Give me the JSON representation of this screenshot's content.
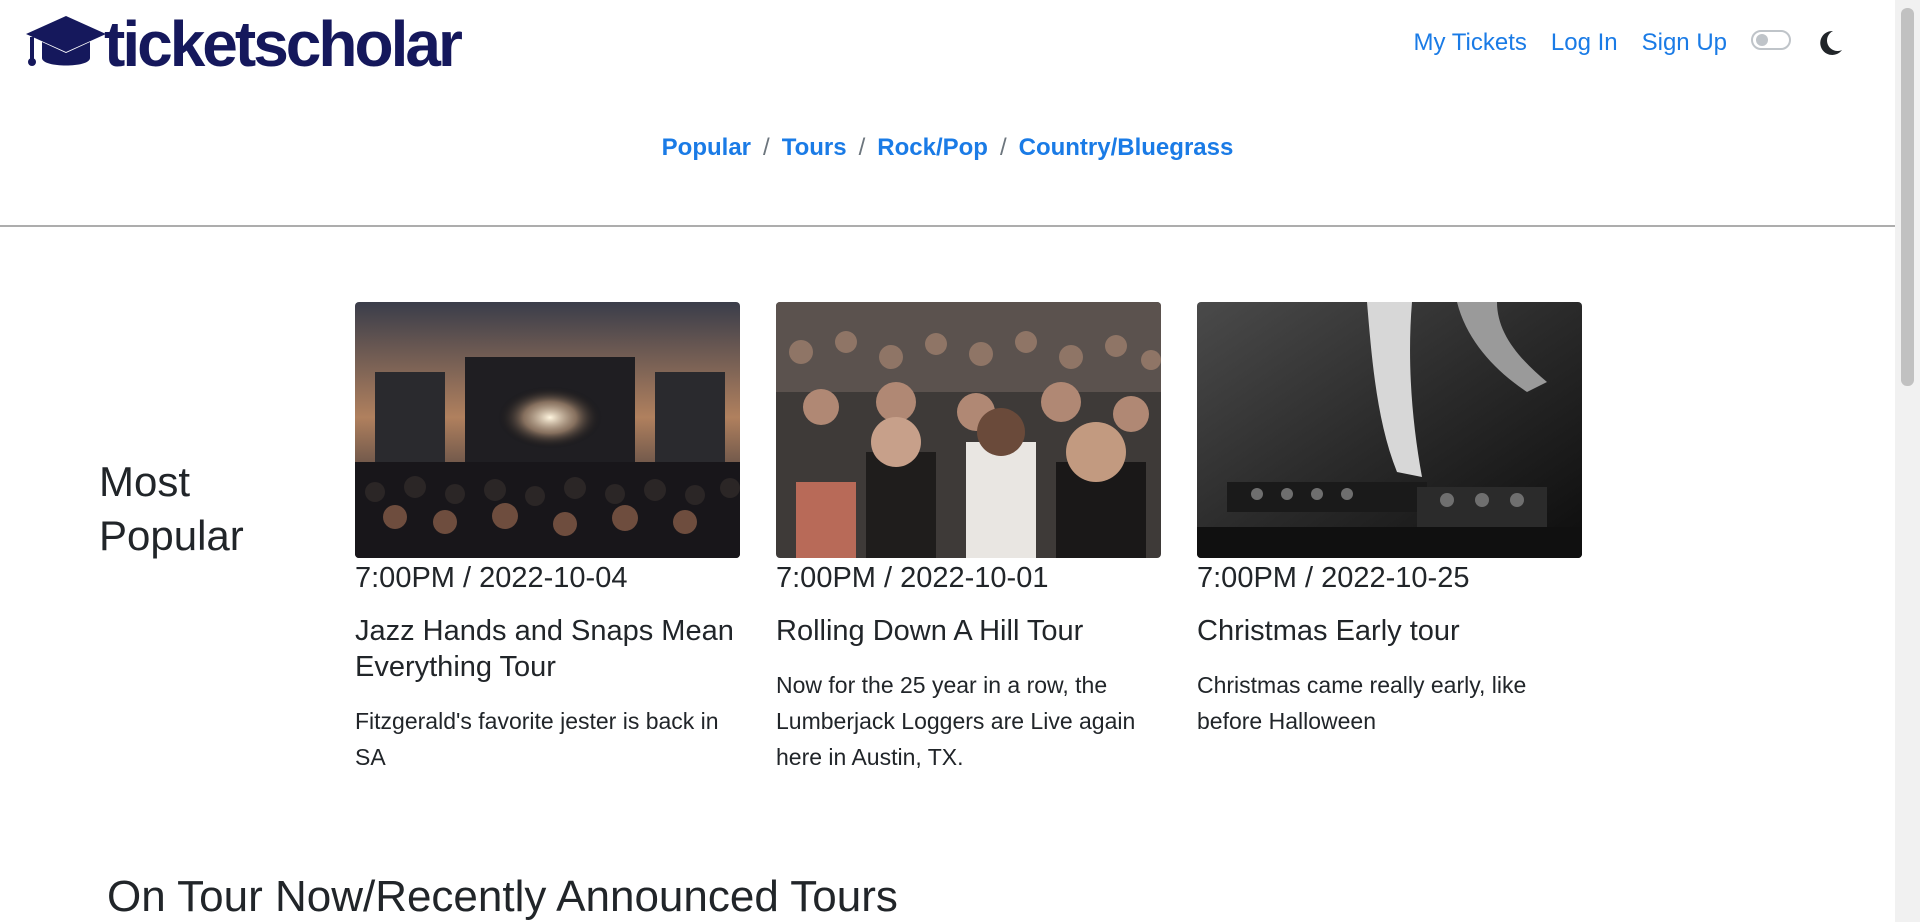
{
  "brand": {
    "name": "ticketscholar"
  },
  "topnav": {
    "my_tickets": "My Tickets",
    "log_in": "Log In",
    "sign_up": "Sign Up"
  },
  "categories": [
    "Popular",
    "Tours",
    "Rock/Pop",
    "Country/Bluegrass"
  ],
  "category_separator": "/",
  "most_popular": {
    "title": "Most Popular",
    "cards": [
      {
        "date": "7:00PM / 2022-10-04",
        "title": "Jazz Hands and Snaps Mean Everything Tour",
        "desc": "Fitzgerald's favorite jester is back in SA"
      },
      {
        "date": "7:00PM / 2022-10-01",
        "title": "Rolling Down A Hill Tour",
        "desc": "Now for the 25 year in a row, the Lumberjack Loggers are Live again here in Austin, TX."
      },
      {
        "date": "7:00PM / 2022-10-25",
        "title": "Christmas Early tour",
        "desc": "Christmas came really early, like before Halloween"
      }
    ]
  },
  "tours_heading": "On Tour Now/Recently Announced Tours",
  "colors": {
    "brand": "#15185c",
    "link": "#1a7be6"
  }
}
